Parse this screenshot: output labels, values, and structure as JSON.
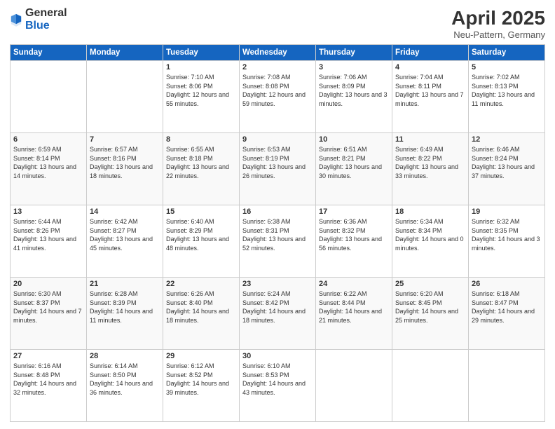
{
  "header": {
    "logo": {
      "general": "General",
      "blue": "Blue"
    },
    "title": "April 2025",
    "subtitle": "Neu-Pattern, Germany"
  },
  "calendar": {
    "weekdays": [
      "Sunday",
      "Monday",
      "Tuesday",
      "Wednesday",
      "Thursday",
      "Friday",
      "Saturday"
    ],
    "weeks": [
      [
        {
          "day": "",
          "info": ""
        },
        {
          "day": "",
          "info": ""
        },
        {
          "day": "1",
          "info": "Sunrise: 7:10 AM\nSunset: 8:06 PM\nDaylight: 12 hours and 55 minutes."
        },
        {
          "day": "2",
          "info": "Sunrise: 7:08 AM\nSunset: 8:08 PM\nDaylight: 12 hours and 59 minutes."
        },
        {
          "day": "3",
          "info": "Sunrise: 7:06 AM\nSunset: 8:09 PM\nDaylight: 13 hours and 3 minutes."
        },
        {
          "day": "4",
          "info": "Sunrise: 7:04 AM\nSunset: 8:11 PM\nDaylight: 13 hours and 7 minutes."
        },
        {
          "day": "5",
          "info": "Sunrise: 7:02 AM\nSunset: 8:13 PM\nDaylight: 13 hours and 11 minutes."
        }
      ],
      [
        {
          "day": "6",
          "info": "Sunrise: 6:59 AM\nSunset: 8:14 PM\nDaylight: 13 hours and 14 minutes."
        },
        {
          "day": "7",
          "info": "Sunrise: 6:57 AM\nSunset: 8:16 PM\nDaylight: 13 hours and 18 minutes."
        },
        {
          "day": "8",
          "info": "Sunrise: 6:55 AM\nSunset: 8:18 PM\nDaylight: 13 hours and 22 minutes."
        },
        {
          "day": "9",
          "info": "Sunrise: 6:53 AM\nSunset: 8:19 PM\nDaylight: 13 hours and 26 minutes."
        },
        {
          "day": "10",
          "info": "Sunrise: 6:51 AM\nSunset: 8:21 PM\nDaylight: 13 hours and 30 minutes."
        },
        {
          "day": "11",
          "info": "Sunrise: 6:49 AM\nSunset: 8:22 PM\nDaylight: 13 hours and 33 minutes."
        },
        {
          "day": "12",
          "info": "Sunrise: 6:46 AM\nSunset: 8:24 PM\nDaylight: 13 hours and 37 minutes."
        }
      ],
      [
        {
          "day": "13",
          "info": "Sunrise: 6:44 AM\nSunset: 8:26 PM\nDaylight: 13 hours and 41 minutes."
        },
        {
          "day": "14",
          "info": "Sunrise: 6:42 AM\nSunset: 8:27 PM\nDaylight: 13 hours and 45 minutes."
        },
        {
          "day": "15",
          "info": "Sunrise: 6:40 AM\nSunset: 8:29 PM\nDaylight: 13 hours and 48 minutes."
        },
        {
          "day": "16",
          "info": "Sunrise: 6:38 AM\nSunset: 8:31 PM\nDaylight: 13 hours and 52 minutes."
        },
        {
          "day": "17",
          "info": "Sunrise: 6:36 AM\nSunset: 8:32 PM\nDaylight: 13 hours and 56 minutes."
        },
        {
          "day": "18",
          "info": "Sunrise: 6:34 AM\nSunset: 8:34 PM\nDaylight: 14 hours and 0 minutes."
        },
        {
          "day": "19",
          "info": "Sunrise: 6:32 AM\nSunset: 8:35 PM\nDaylight: 14 hours and 3 minutes."
        }
      ],
      [
        {
          "day": "20",
          "info": "Sunrise: 6:30 AM\nSunset: 8:37 PM\nDaylight: 14 hours and 7 minutes."
        },
        {
          "day": "21",
          "info": "Sunrise: 6:28 AM\nSunset: 8:39 PM\nDaylight: 14 hours and 11 minutes."
        },
        {
          "day": "22",
          "info": "Sunrise: 6:26 AM\nSunset: 8:40 PM\nDaylight: 14 hours and 18 minutes."
        },
        {
          "day": "23",
          "info": "Sunrise: 6:24 AM\nSunset: 8:42 PM\nDaylight: 14 hours and 18 minutes."
        },
        {
          "day": "24",
          "info": "Sunrise: 6:22 AM\nSunset: 8:44 PM\nDaylight: 14 hours and 21 minutes."
        },
        {
          "day": "25",
          "info": "Sunrise: 6:20 AM\nSunset: 8:45 PM\nDaylight: 14 hours and 25 minutes."
        },
        {
          "day": "26",
          "info": "Sunrise: 6:18 AM\nSunset: 8:47 PM\nDaylight: 14 hours and 29 minutes."
        }
      ],
      [
        {
          "day": "27",
          "info": "Sunrise: 6:16 AM\nSunset: 8:48 PM\nDaylight: 14 hours and 32 minutes."
        },
        {
          "day": "28",
          "info": "Sunrise: 6:14 AM\nSunset: 8:50 PM\nDaylight: 14 hours and 36 minutes."
        },
        {
          "day": "29",
          "info": "Sunrise: 6:12 AM\nSunset: 8:52 PM\nDaylight: 14 hours and 39 minutes."
        },
        {
          "day": "30",
          "info": "Sunrise: 6:10 AM\nSunset: 8:53 PM\nDaylight: 14 hours and 43 minutes."
        },
        {
          "day": "",
          "info": ""
        },
        {
          "day": "",
          "info": ""
        },
        {
          "day": "",
          "info": ""
        }
      ]
    ]
  }
}
